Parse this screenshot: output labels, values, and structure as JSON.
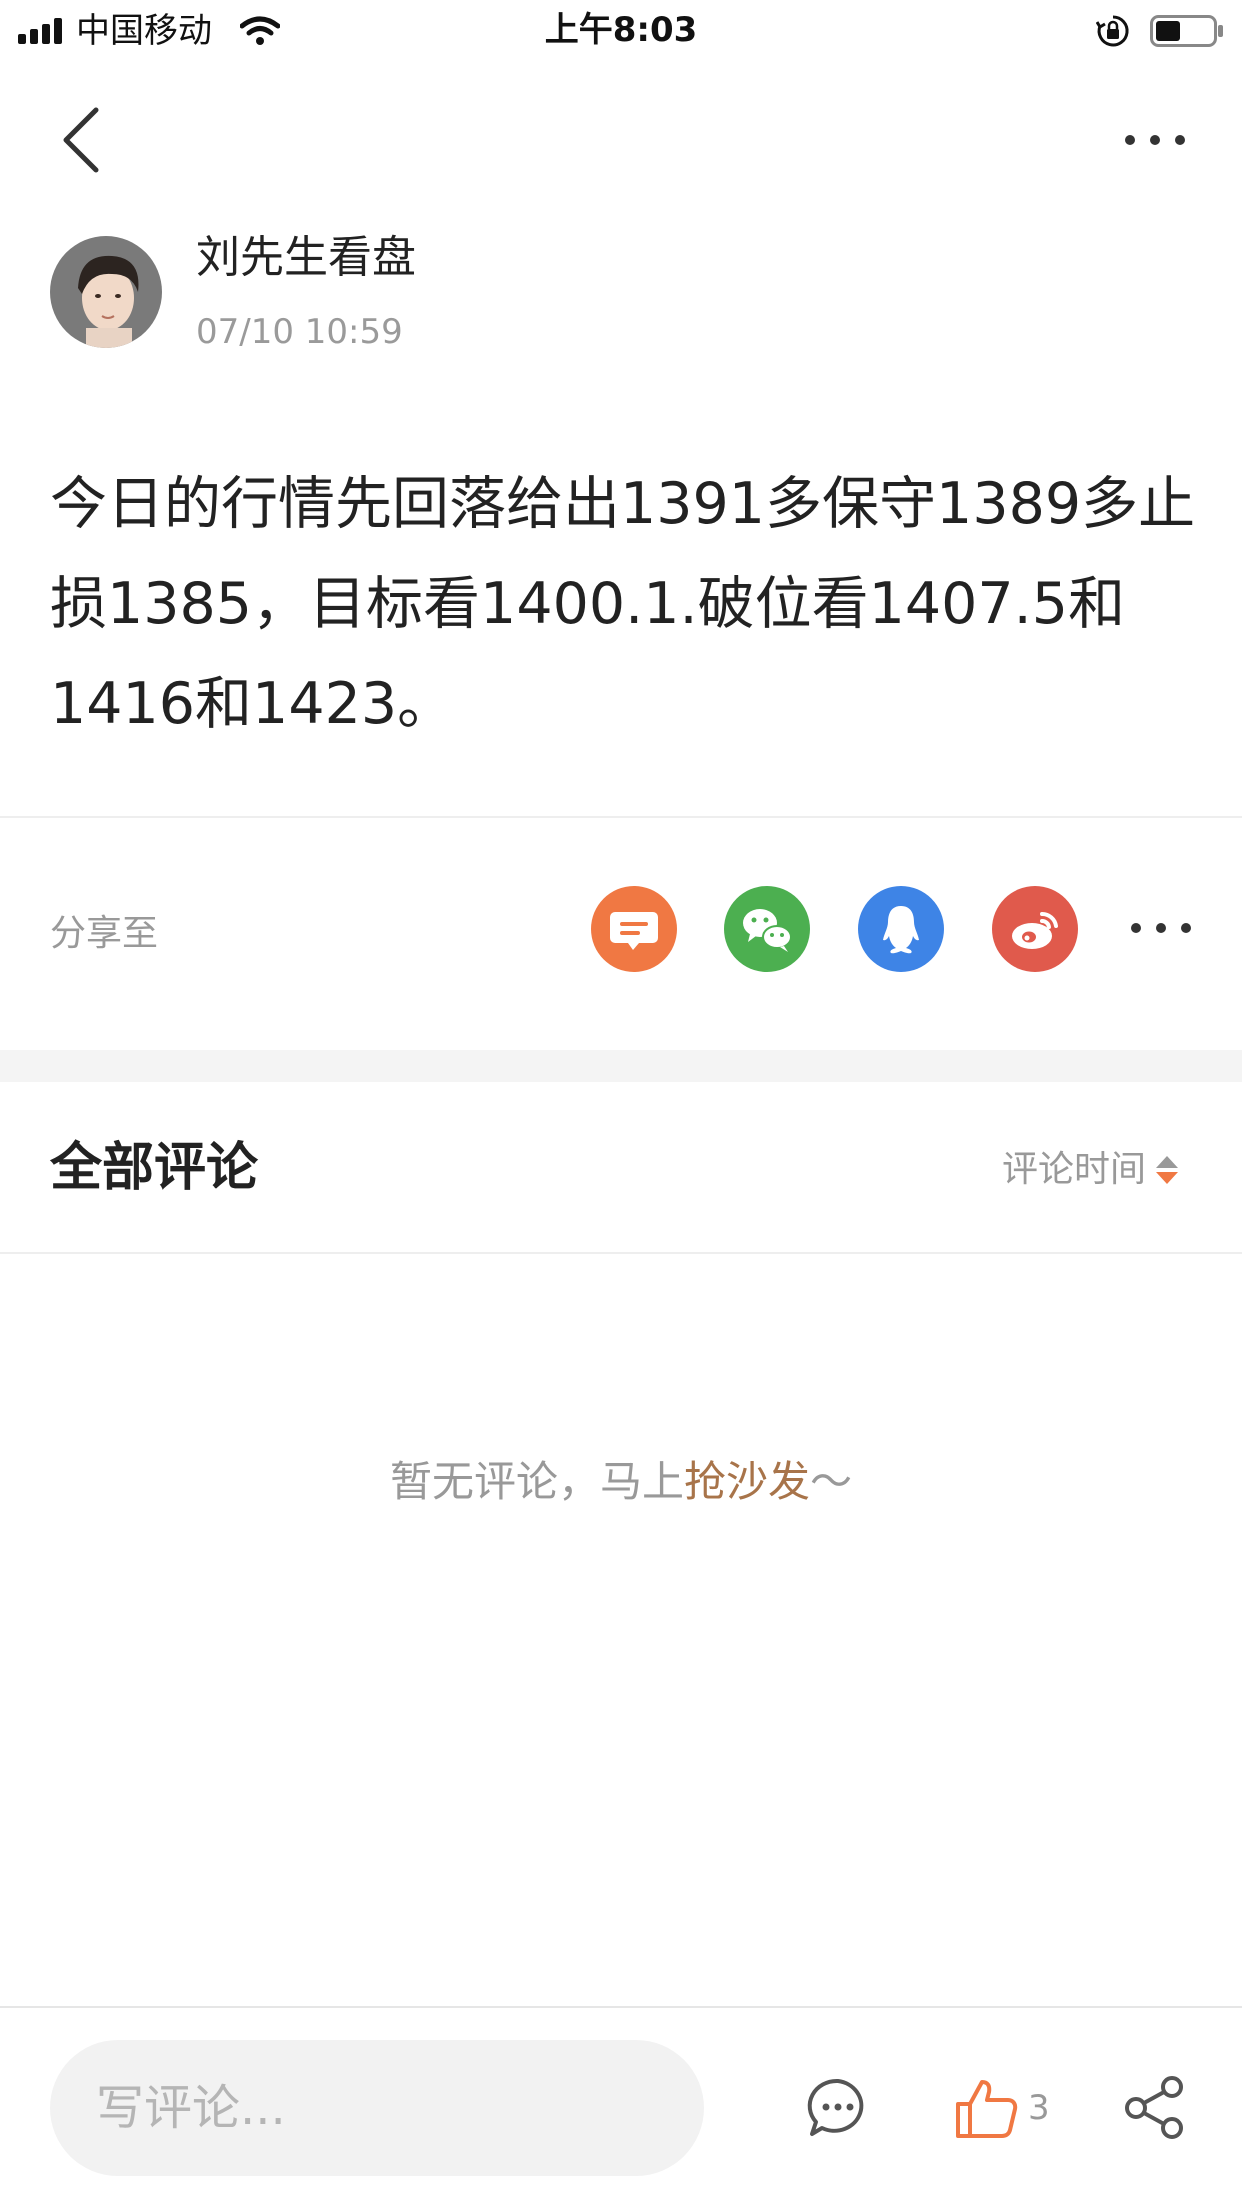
{
  "status_bar": {
    "carrier": "中国移动",
    "time": "上午8:03"
  },
  "author": {
    "name": "刘先生看盘",
    "time": "07/10 10:59"
  },
  "post": {
    "content": "今日的行情先回落给出1391多保守1389多止损1385，目标看1400.1.破位看1407.5和1416和1423。"
  },
  "share": {
    "label": "分享至",
    "icons": [
      "message-icon",
      "wechat-icon",
      "qq-icon",
      "weibo-icon",
      "more-icon"
    ]
  },
  "comments": {
    "title": "全部评论",
    "sort_label": "评论时间",
    "empty_text": "暂无评论，马上",
    "empty_link": "抢沙发",
    "empty_suffix": "～"
  },
  "bottom_bar": {
    "input_placeholder": "写评论...",
    "like_count": "3"
  },
  "colors": {
    "accent": "#f07843",
    "link": "#a8744a",
    "wechat": "#4caf50",
    "qq": "#3e84e6",
    "weibo": "#e05a4c"
  }
}
